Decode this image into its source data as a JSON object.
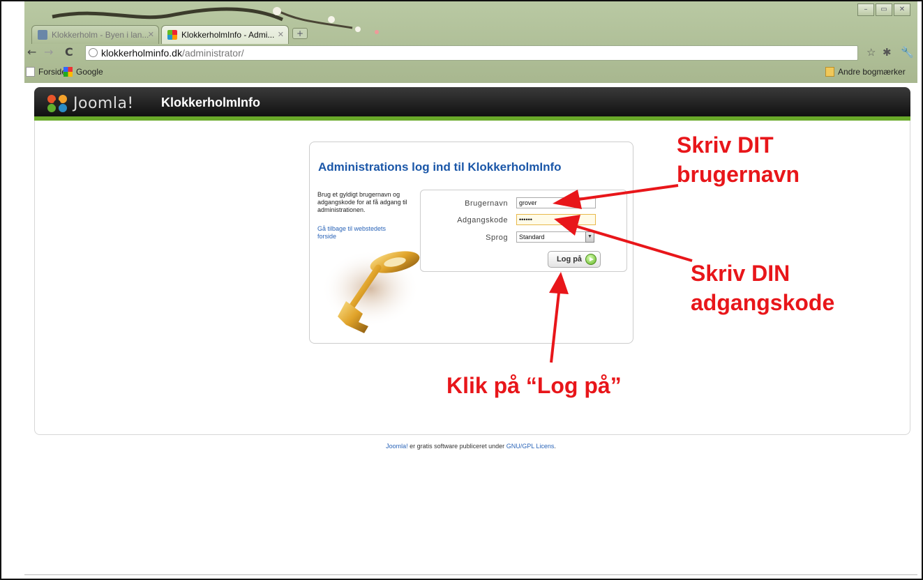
{
  "browser": {
    "tabs": [
      {
        "label": "Klokkerholm - Byen i lan...",
        "active": false
      },
      {
        "label": "KlokkerholmInfo - Admi...",
        "active": true
      }
    ],
    "address": {
      "domain": "klokkerholminfo.dk",
      "path": "/administrator/"
    },
    "bookmarks": {
      "left": [
        {
          "label": "Forside"
        },
        {
          "label": "Google"
        }
      ],
      "right": "Andre bogmærker"
    }
  },
  "header": {
    "logo_text": "Joomla!",
    "site_name": "KlokkerholmInfo",
    "accent_color": "#6aaa2a"
  },
  "login": {
    "title": "Administrations log ind til KlokkerholmInfo",
    "description": "Brug et gyldigt brugernavn og adgangskode for at få adgang til administrationen.",
    "back_link": "Gå tilbage til webstedets forside",
    "fields": {
      "username_label": "Brugernavn",
      "username_value": "grover",
      "password_label": "Adgangskode",
      "password_value": "••••••",
      "language_label": "Sprog",
      "language_value": "Standard"
    },
    "button_label": "Log på"
  },
  "footer": {
    "joomla": "Joomla!",
    "text_mid": " er gratis software publiceret under ",
    "license": "GNU/GPL Licens",
    "period": "."
  },
  "annotations": {
    "username": [
      "Skriv DIT",
      "brugernavn"
    ],
    "password": [
      "Skriv DIN",
      "adgangskode"
    ],
    "button": "Klik på “Log på”",
    "color": "#e8161a"
  }
}
